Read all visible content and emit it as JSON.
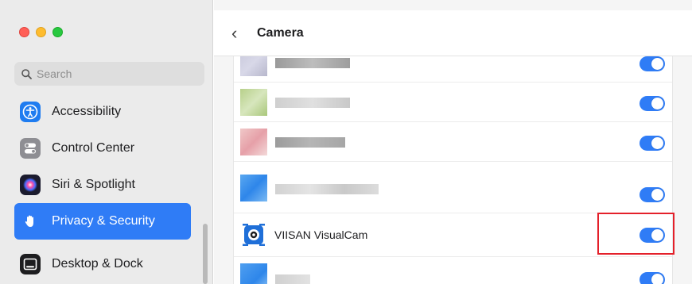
{
  "window": {
    "title": "Camera"
  },
  "search": {
    "placeholder": "Search"
  },
  "sidebar": {
    "items": [
      {
        "label": "Accessibility",
        "icon": "accessibility-icon",
        "color": "#1f7cf0",
        "active": false
      },
      {
        "label": "Control Center",
        "icon": "control-center-icon",
        "color": "#8e8e93",
        "active": false
      },
      {
        "label": "Siri & Spotlight",
        "icon": "siri-icon",
        "color": "#4b2b8c",
        "active": false
      },
      {
        "label": "Privacy & Security",
        "icon": "hand-icon",
        "color": "#2f7cf6",
        "active": true
      },
      {
        "label": "Desktop & Dock",
        "icon": "desktop-dock-icon",
        "color": "#1d1d1f",
        "active": false
      }
    ]
  },
  "apps": {
    "rows": [
      {
        "name": "",
        "blurred": true,
        "enabled": true
      },
      {
        "name": "",
        "blurred": true,
        "enabled": true
      },
      {
        "name": "",
        "blurred": true,
        "enabled": true
      },
      {
        "name": "",
        "blurred": true,
        "enabled": true
      },
      {
        "name": "VIISAN VisualCam",
        "blurred": false,
        "enabled": true,
        "icon": "viisan-camera-icon"
      },
      {
        "name": "",
        "blurred": true,
        "enabled": true
      }
    ]
  },
  "colors": {
    "accent": "#2f7cf6",
    "highlight": "#e4202a"
  }
}
